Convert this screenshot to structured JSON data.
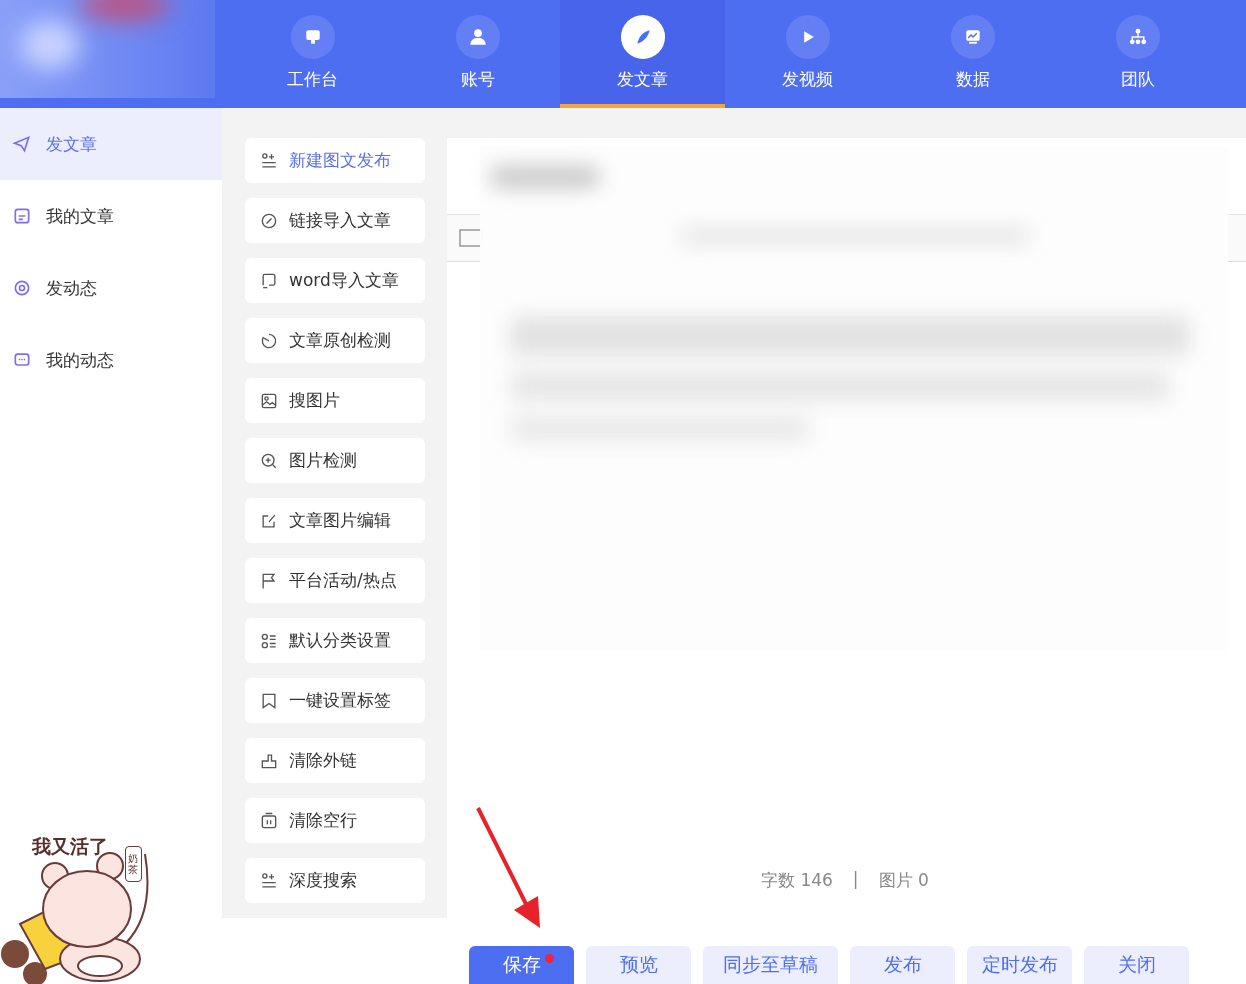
{
  "nav": [
    {
      "label": "工作台",
      "selected": false
    },
    {
      "label": "账号",
      "selected": false
    },
    {
      "label": "发文章",
      "selected": true
    },
    {
      "label": "发视频",
      "selected": false
    },
    {
      "label": "数据",
      "selected": false
    },
    {
      "label": "团队",
      "selected": false
    }
  ],
  "sidebar": [
    {
      "label": "发文章",
      "selected": true
    },
    {
      "label": "我的文章",
      "selected": false
    },
    {
      "label": "发动态",
      "selected": false
    },
    {
      "label": "我的动态",
      "selected": false
    }
  ],
  "tools": [
    {
      "label": "新建图文发布",
      "selected": true
    },
    {
      "label": "链接导入文章",
      "selected": false
    },
    {
      "label": "word导入文章",
      "selected": false
    },
    {
      "label": "文章原创检测",
      "selected": false
    },
    {
      "label": "搜图片",
      "selected": false
    },
    {
      "label": "图片检测",
      "selected": false
    },
    {
      "label": "文章图片编辑",
      "selected": false
    },
    {
      "label": "平台活动/热点",
      "selected": false
    },
    {
      "label": "默认分类设置",
      "selected": false
    },
    {
      "label": "一键设置标签",
      "selected": false
    },
    {
      "label": "清除外链",
      "selected": false
    },
    {
      "label": "清除空行",
      "selected": false
    },
    {
      "label": "深度搜索",
      "selected": false
    }
  ],
  "editor": {
    "word_count": "字数 146",
    "separator": "|",
    "image_count": "图片 0"
  },
  "sticker": {
    "caption": "我又活了",
    "bag_label": "奶茶"
  },
  "actions": [
    {
      "label": "保存",
      "kind": "primary",
      "unsaved": true
    },
    {
      "label": "预览",
      "kind": "secondary",
      "unsaved": false
    },
    {
      "label": "同步至草稿",
      "kind": "secondary",
      "unsaved": false
    },
    {
      "label": "发布",
      "kind": "secondary",
      "unsaved": false
    },
    {
      "label": "定时发布",
      "kind": "secondary",
      "unsaved": false
    },
    {
      "label": "关闭",
      "kind": "secondary",
      "unsaved": false
    }
  ]
}
